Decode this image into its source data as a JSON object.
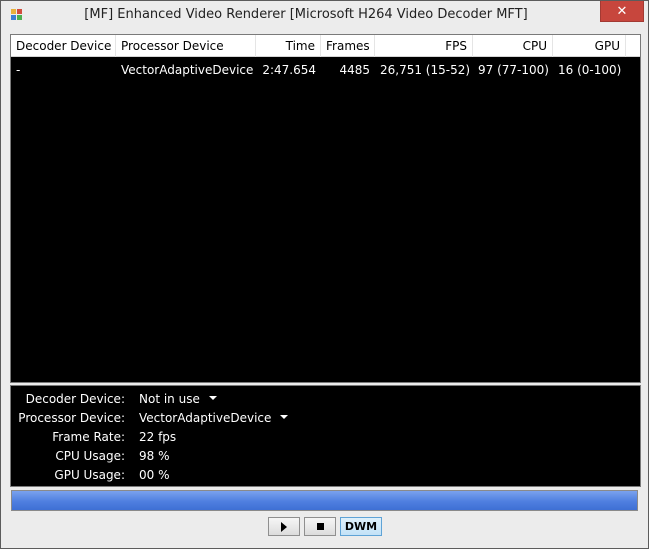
{
  "window": {
    "title": "[MF]  Enhanced Video Renderer  [Microsoft H264 Video Decoder MFT]",
    "close_label": "✕"
  },
  "table": {
    "headers": [
      "Decoder Device",
      "Processor Device",
      "Time",
      "Frames",
      "FPS",
      "CPU",
      "GPU"
    ],
    "rows": [
      [
        "-",
        "VectorAdaptiveDevice",
        "2:47.654",
        "4485",
        "26,751 (15-52)",
        "97 (77-100)",
        "16 (0-100)"
      ]
    ]
  },
  "info": {
    "decoder_device_label": "Decoder Device:",
    "decoder_device_value": "Not in use",
    "processor_device_label": "Processor Device:",
    "processor_device_value": "VectorAdaptiveDevice",
    "frame_rate_label": "Frame Rate:",
    "frame_rate_value": "22 fps",
    "cpu_usage_label": "CPU Usage:",
    "cpu_usage_value": "98 %",
    "gpu_usage_label": "GPU Usage:",
    "gpu_usage_value": "00 %"
  },
  "progress": {
    "fraction": 1.0
  },
  "controls": {
    "dwm_label": "DWM"
  },
  "colors": {
    "accent": "#4f7fe0",
    "close": "#c7463d",
    "panel_bg": "#000000"
  }
}
